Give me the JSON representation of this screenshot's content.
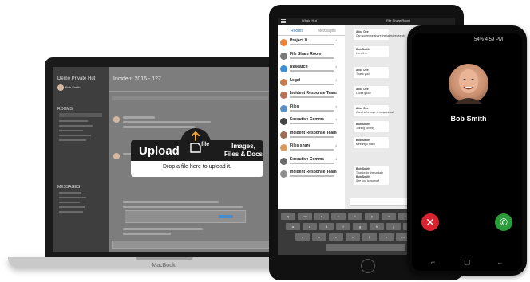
{
  "laptop": {
    "brand_label": "MacBook",
    "sidebar": {
      "team_name": "Demo Private Hut",
      "user_name": "Bob Smith",
      "rooms_header": "ROOMS",
      "messages_header": "MESSAGES"
    },
    "main": {
      "room_title": "Incident 2016 - 127",
      "upload_overlay": {
        "title": "Upload",
        "file_word": "file",
        "subtitle_line1": "Images,",
        "subtitle_line2": "Files & Docs",
        "drop_text": "Drop a file here to upload it."
      }
    }
  },
  "tablet": {
    "header_title": "Whole Hut",
    "tabs": [
      "Rooms",
      "Messages"
    ],
    "rooms": [
      {
        "name": "Project X",
        "count": "4",
        "color": "#e8843c"
      },
      {
        "name": "File Share Room",
        "count": "",
        "color": "#7a7a7a"
      },
      {
        "name": "Research",
        "count": "4",
        "color": "#3b8fd6"
      },
      {
        "name": "Legal",
        "count": "4",
        "color": "#c97c4e"
      },
      {
        "name": "Incident Response Team",
        "count": "4",
        "color": "#b5735a"
      },
      {
        "name": "Files",
        "count": "4",
        "color": "#5c8fc4"
      },
      {
        "name": "Executive Comms",
        "count": "4",
        "color": "#444444"
      },
      {
        "name": "Incident Response Team",
        "count": "3",
        "color": "#9e6b55"
      },
      {
        "name": "Files share",
        "count": "4",
        "color": "#d89a5e"
      },
      {
        "name": "Executive Comms",
        "count": "4",
        "color": "#6a6a6a"
      },
      {
        "name": "Incident Response Team",
        "count": "3",
        "color": "#8e8e8e"
      }
    ],
    "chat_header": "File Share Room",
    "chat_messages": [
      {
        "name": "Alice Dee",
        "text": "Can someone share the latest research"
      },
      {
        "name": "Bob Smith",
        "text": "Here it is"
      },
      {
        "name": "Alice Dee",
        "text": "Thank you!"
      },
      {
        "name": "Alice Dee",
        "text": "Looks good!"
      },
      {
        "name": "Alice Dee",
        "text": "Great let's hope on a quick call"
      },
      {
        "name": "Bob Smith",
        "text": "Joining Shortly"
      },
      {
        "name": "Bob Smith",
        "text": "Meeting Ended"
      },
      {
        "name": "Bob Smith",
        "text": "Thanks for the update"
      },
      {
        "name": "Bob Smith",
        "text": "See you tomorrow!"
      }
    ],
    "keyboard_rows": [
      [
        "q",
        "w",
        "e",
        "r",
        "t",
        "y",
        "u",
        "i",
        "o",
        "p"
      ],
      [
        "a",
        "s",
        "d",
        "f",
        "g",
        "h",
        "j",
        "k",
        "l"
      ],
      [
        "z",
        "x",
        "c",
        "v",
        "b",
        "n",
        "m"
      ]
    ]
  },
  "phone": {
    "status_text": "54% 4:59 PM",
    "caller_name": "Bob Smith",
    "decline_symbol": "✕",
    "accept_symbol": "✆"
  }
}
